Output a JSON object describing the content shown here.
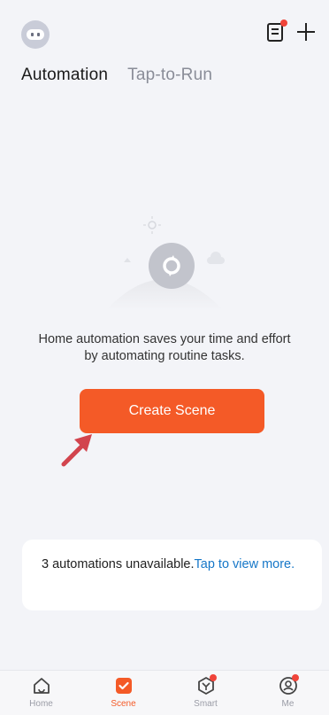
{
  "header": {
    "tabs": [
      {
        "label": "Automation",
        "active": true
      },
      {
        "label": "Tap-to-Run",
        "active": false
      }
    ]
  },
  "empty_state": {
    "description": "Home automation saves your time and effort by automating routine tasks.",
    "create_button": "Create Scene"
  },
  "notice": {
    "text": "3 automations unavailable.",
    "link": "Tap to view more."
  },
  "bottom_nav": {
    "items": [
      {
        "label": "Home",
        "icon": "home-icon"
      },
      {
        "label": "Scene",
        "icon": "scene-icon",
        "active": true
      },
      {
        "label": "Smart",
        "icon": "smart-icon",
        "badge": true
      },
      {
        "label": "Me",
        "icon": "profile-icon",
        "badge": true
      }
    ]
  },
  "colors": {
    "accent": "#f45a27",
    "background": "#f3f4f8",
    "link": "#1677c8",
    "badge": "#f0443a"
  }
}
